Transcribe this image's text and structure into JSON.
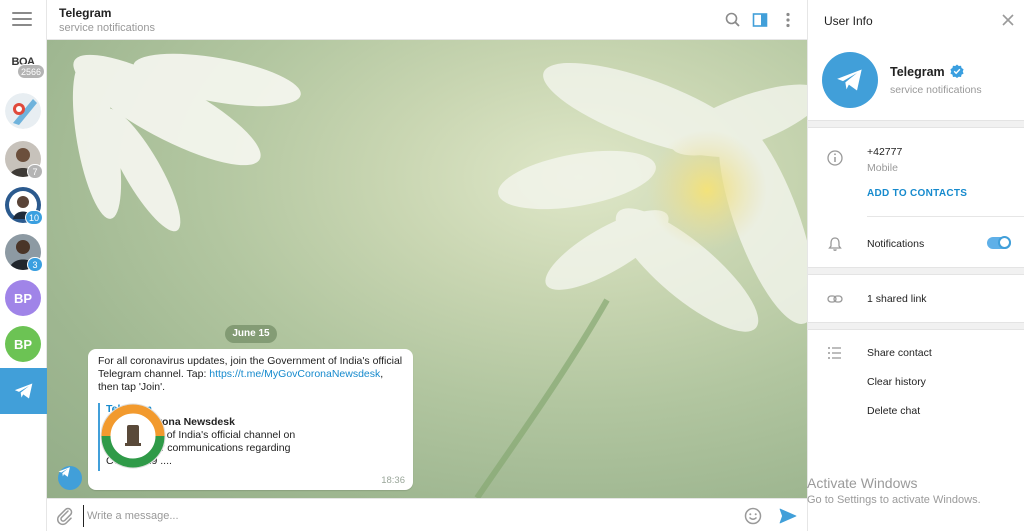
{
  "rail": {
    "chats": [
      {
        "name": "chat-boa",
        "badge": "2566"
      },
      {
        "name": "chat-sticker",
        "badge": ""
      },
      {
        "name": "chat-person-1",
        "badge": "7"
      },
      {
        "name": "chat-person-2",
        "badge": "10"
      },
      {
        "name": "chat-person-3",
        "badge": "3"
      },
      {
        "initials": "BP"
      },
      {
        "initials": "BP"
      }
    ],
    "boa_text": "BOA"
  },
  "chat": {
    "title": "Telegram",
    "subtitle": "service notifications",
    "date": "June 15",
    "message": {
      "text_before": "For all coronavirus updates, join the Government of India's official Telegram channel. Tap: ",
      "link": "https://t.me/MyGovCoronaNewsdesk",
      "text_after": ", then tap 'Join'.",
      "preview_site": "Telegram",
      "preview_title": "MyGov Corona Newsdesk",
      "preview_desc": "Government of India's official channel  on Telegram for communications regarding COVID -19 ....",
      "time": "18:36"
    },
    "composer_placeholder": "Write a message..."
  },
  "info": {
    "title": "User Info",
    "name": "Telegram",
    "subtitle": "service notifications",
    "phone": "+42777",
    "phone_label": "Mobile",
    "add_contacts": "ADD TO CONTACTS",
    "notifications": "Notifications",
    "notifications_on": true,
    "shared_links": "1 shared link",
    "actions": [
      "Share contact",
      "Clear history",
      "Delete chat"
    ]
  },
  "watermark": {
    "line1": "Activate Windows",
    "line2": "Go to Settings to activate Windows."
  },
  "colors": {
    "accent": "#419fd9",
    "link": "#168acd",
    "badge_gray": "#b4b4b4",
    "bp_purple": "#a084e8",
    "bp_green": "#6cc354"
  }
}
